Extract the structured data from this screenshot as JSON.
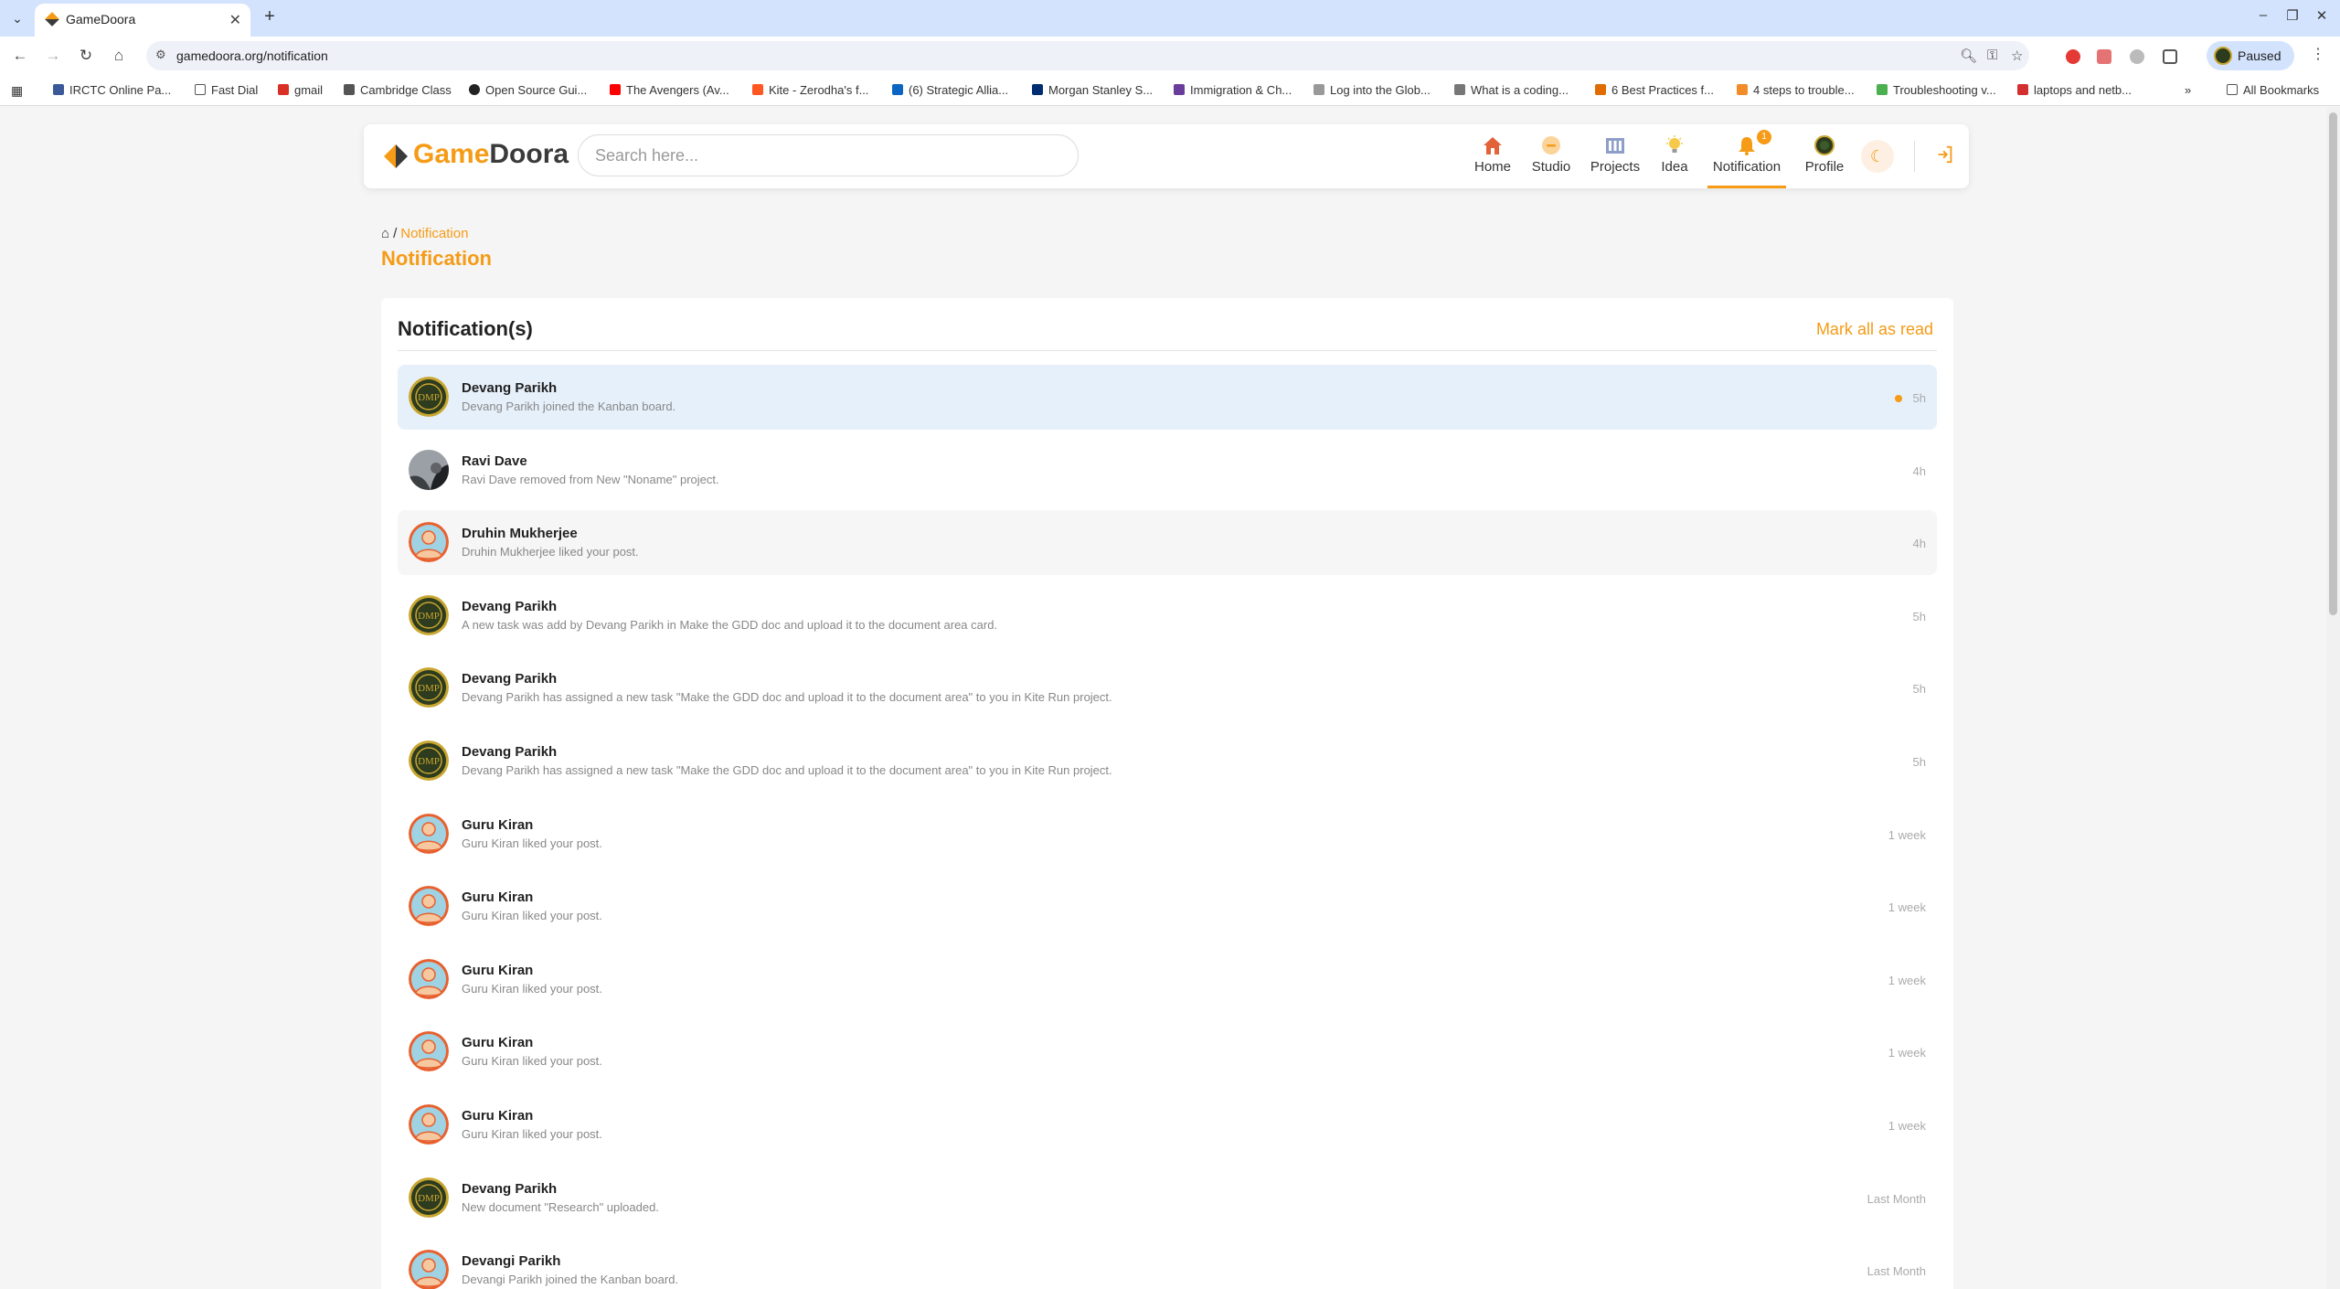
{
  "browser": {
    "tab_title": "GameDoora",
    "url": "gamedoora.org/notification",
    "profile_label": "Paused",
    "bookmarks": [
      {
        "label": "IRCTC Online Pa...",
        "color": "#3b5998"
      },
      {
        "label": "Fast Dial",
        "color": "#888888"
      },
      {
        "label": "gmail",
        "color": "#d93025"
      },
      {
        "label": "Cambridge Class",
        "color": "#555555"
      },
      {
        "label": "Open Source Gui...",
        "color": "#222222"
      },
      {
        "label": "The Avengers (Av...",
        "color": "#ff0000"
      },
      {
        "label": "Kite - Zerodha's f...",
        "color": "#ff5722"
      },
      {
        "label": "(6) Strategic Allia...",
        "color": "#0a66c2"
      },
      {
        "label": "Morgan Stanley S...",
        "color": "#002d72"
      },
      {
        "label": "Immigration & Ch...",
        "color": "#6a3d9a"
      },
      {
        "label": "Log into the Glob...",
        "color": "#999999"
      },
      {
        "label": "What is a coding...",
        "color": "#777777"
      },
      {
        "label": "6 Best Practices f...",
        "color": "#e06c00"
      },
      {
        "label": "4 steps to trouble...",
        "color": "#f28c28"
      },
      {
        "label": "Troubleshooting v...",
        "color": "#4caf50"
      },
      {
        "label": "laptops and netb...",
        "color": "#d32f2f"
      }
    ],
    "all_bookmarks_label": "All Bookmarks"
  },
  "header": {
    "logo_part1": "Game",
    "logo_part2": "Doora",
    "search_placeholder": "Search here...",
    "nav": [
      {
        "label": "Home",
        "icon": "home-icon"
      },
      {
        "label": "Studio",
        "icon": "studio-icon"
      },
      {
        "label": "Projects",
        "icon": "projects-icon"
      },
      {
        "label": "Idea",
        "icon": "idea-icon"
      },
      {
        "label": "Notification",
        "icon": "bell-icon",
        "badge": "1",
        "active": true
      },
      {
        "label": "Profile",
        "icon": "avatar"
      }
    ]
  },
  "breadcrumb": {
    "current": "Notification"
  },
  "page_title": "Notification",
  "card": {
    "title": "Notification(s)",
    "mark_all_label": "Mark all as read"
  },
  "notifications": [
    {
      "name": "Devang Parikh",
      "message": "Devang Parikh joined the Kanban board.",
      "time": "5h",
      "avatar": "dmp",
      "unread": true
    },
    {
      "name": "Ravi Dave",
      "message": "Ravi Dave removed from New \"Noname\" project.",
      "time": "4h",
      "avatar": "photo",
      "unread": false
    },
    {
      "name": "Druhin Mukherjee",
      "message": "Druhin Mukherjee liked your post.",
      "time": "4h",
      "avatar": "default",
      "unread": false
    },
    {
      "name": "Devang Parikh",
      "message": "A new task was add by Devang Parikh in Make the GDD doc and upload it to the document area card.",
      "time": "5h",
      "avatar": "dmp",
      "unread": false
    },
    {
      "name": "Devang Parikh",
      "message": "Devang Parikh has assigned a new task \"Make the GDD doc and upload it to the document area\" to you in Kite Run project.",
      "time": "5h",
      "avatar": "dmp",
      "unread": false
    },
    {
      "name": "Devang Parikh",
      "message": "Devang Parikh has assigned a new task \"Make the GDD doc and upload it to the document area\" to you in Kite Run project.",
      "time": "5h",
      "avatar": "dmp",
      "unread": false
    },
    {
      "name": "Guru Kiran",
      "message": "Guru Kiran liked your post.",
      "time": "1 week",
      "avatar": "default",
      "unread": false
    },
    {
      "name": "Guru Kiran",
      "message": "Guru Kiran liked your post.",
      "time": "1 week",
      "avatar": "default",
      "unread": false
    },
    {
      "name": "Guru Kiran",
      "message": "Guru Kiran liked your post.",
      "time": "1 week",
      "avatar": "default",
      "unread": false
    },
    {
      "name": "Guru Kiran",
      "message": "Guru Kiran liked your post.",
      "time": "1 week",
      "avatar": "default",
      "unread": false
    },
    {
      "name": "Guru Kiran",
      "message": "Guru Kiran liked your post.",
      "time": "1 week",
      "avatar": "default",
      "unread": false
    },
    {
      "name": "Devang Parikh",
      "message": "New document \"Research\" uploaded.",
      "time": "Last Month",
      "avatar": "dmp",
      "unread": false
    },
    {
      "name": "Devangi Parikh",
      "message": "Devangi Parikh joined the Kanban board.",
      "time": "Last Month",
      "avatar": "default",
      "unread": false
    }
  ],
  "colors": {
    "accent": "#f59b16",
    "unread_bg": "#e6f0fa"
  }
}
